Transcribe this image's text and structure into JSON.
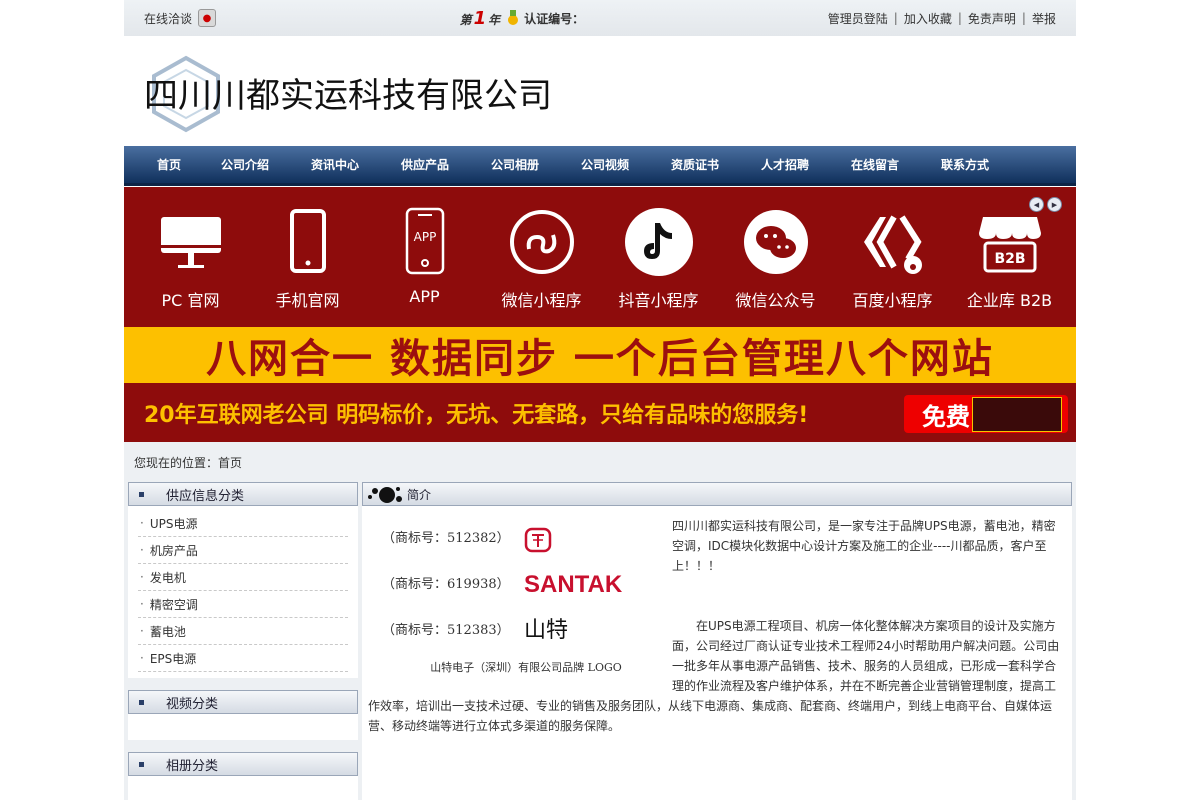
{
  "topbar": {
    "online_chat": "在线洽谈",
    "year_prefix": "第",
    "year_num": "1",
    "year_suffix": "年",
    "cert_label": "认证编号：",
    "links": [
      "管理员登陆",
      "加入收藏",
      "免责声明",
      "举报"
    ]
  },
  "header": {
    "company_name": "四川川都实运科技有限公司"
  },
  "nav": [
    "首页",
    "公司介绍",
    "资讯中心",
    "供应产品",
    "公司相册",
    "公司视频",
    "资质证书",
    "人才招聘",
    "在线留言",
    "联系方式"
  ],
  "banner": {
    "services": [
      {
        "label": "PC 官网",
        "icon": "desktop-icon"
      },
      {
        "label": "手机官网",
        "icon": "mobile-icon"
      },
      {
        "label": "APP",
        "icon": "app-icon"
      },
      {
        "label": "微信小程序",
        "icon": "miniprogram-icon"
      },
      {
        "label": "抖音小程序",
        "icon": "douyin-icon"
      },
      {
        "label": "微信公众号",
        "icon": "wechat-icon"
      },
      {
        "label": "百度小程序",
        "icon": "baidu-icon"
      },
      {
        "label": "企业库 B2B",
        "icon": "b2b-icon"
      }
    ],
    "headline": "八网合一  数据同步  一个后台管理八个网站",
    "slogan": "20年互联网老公司  明码标价，无坑、无套路，只给有品味的您服务!",
    "free_label": "免费",
    "colors": {
      "red": "#8e0c0c",
      "yellow": "#fdc000"
    }
  },
  "location": "您现在的位置：首页",
  "sidebar": {
    "supply_title": "供应信息分类",
    "supply_items": [
      "UPS电源",
      "机房产品",
      "发电机",
      "精密空调",
      "蓄电池",
      "EPS电源"
    ],
    "video_title": "视频分类",
    "album_title": "相册分类"
  },
  "main": {
    "title": "简介",
    "brands": [
      {
        "tm": "（商标号：512382）"
      },
      {
        "tm": "（商标号：619938）",
        "name": "SANTAK"
      },
      {
        "tm": "（商标号：512383）",
        "name": "山特"
      }
    ],
    "brand_caption": "山特电子（深圳）有限公司品牌 LOGO",
    "intro_p1": "四川川都实运科技有限公司，是一家专注于品牌UPS电源，蓄电池，精密空调，IDC模块化数据中心设计方案及施工的企业----川都品质，客户至上！！！",
    "intro_p2": "在UPS电源工程项目、机房一体化整体解决方案项目的设计及实施方面，公司经过厂商认证专业技术工程师24小时帮助用户解决问题。公司由一批多年从事电源产品销售、技术、服务的人员组成，已形成一套科学合理的作业流程及客户维护体系，并在不断完善企业营销管理制度，提高工作效率，培训出一支技术过硬、专业的销售及服务团队，从线下电源商、集成商、配套商、终端用户，到线上电商平台、自媒体运营、移动终端等进行立体式多渠道的服务保障。"
  }
}
